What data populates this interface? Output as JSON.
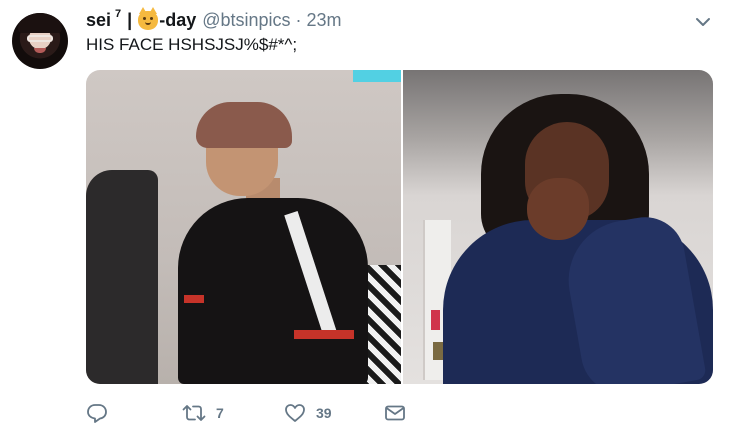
{
  "tweet": {
    "display_name": "sei",
    "superscript": "7",
    "separator": "|",
    "name_suffix": "-day",
    "handle": "@btsinpics",
    "dot": "·",
    "time": "23m",
    "text": "HIS FACE HSHSJSJ%$#*^;",
    "icons": {
      "avatar": "profile-avatar",
      "name_emoji": "cat-face-emoji",
      "menu": "chevron-down-icon"
    }
  },
  "actions": {
    "reply": {
      "icon": "reply-icon",
      "count": ""
    },
    "retweet": {
      "icon": "retweet-icon",
      "count": "7"
    },
    "like": {
      "icon": "heart-icon",
      "count": "39"
    },
    "dm": {
      "icon": "envelope-icon"
    }
  },
  "colors": {
    "text_primary": "#14171a",
    "text_secondary": "#657786",
    "background": "#ffffff"
  }
}
